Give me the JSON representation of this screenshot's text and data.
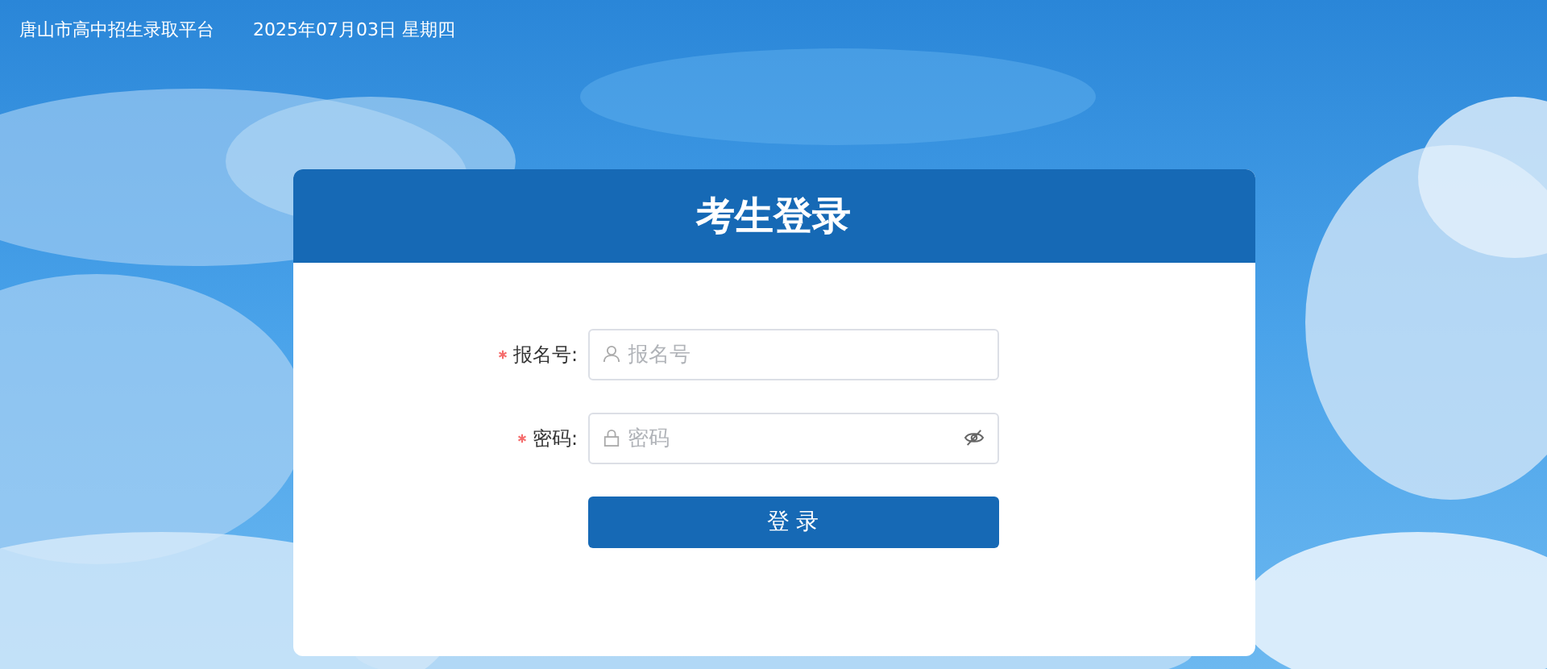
{
  "top_bar": {
    "site_title": "唐山市高中招生录取平台",
    "date": "2025年07月03日 星期四"
  },
  "login_card": {
    "title": "考生登录",
    "fields": [
      {
        "kind": "text",
        "label": "报名号:",
        "placeholder": "报名号",
        "required": true
      },
      {
        "kind": "password",
        "label": "密码:",
        "placeholder": "密码",
        "required": true
      }
    ],
    "submit_button": "登 录"
  }
}
